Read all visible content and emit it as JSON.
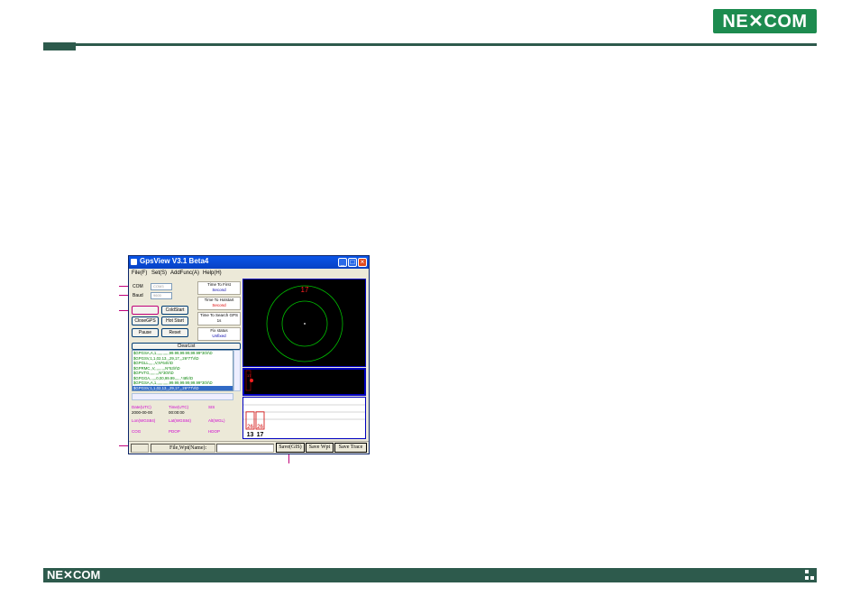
{
  "header": {
    "logo_text": "NE✕COM",
    "accent_color": "#2d5a4c",
    "logo_color": "#1d8b4f"
  },
  "footer": {
    "logo_text": "NE✕COM"
  },
  "window": {
    "title": "GpsView V3.1 Beta4",
    "menu": [
      "File(F)",
      "Set(S)",
      "AddFunc(A)",
      "Help(H)"
    ],
    "com_label": "COM",
    "com_value": "COM3",
    "baud_label": "Baud",
    "baud_value": "9600",
    "buttons": {
      "coldstart": "ColdStart",
      "closegps": "CloseGPS",
      "hotstart": "Hot Start",
      "pause": "Pause",
      "reset": "Reset",
      "clearlist": "ClearList"
    },
    "info": {
      "ttff_title": "Time To First",
      "ttff_value": "Second",
      "tthot_title": "Time To Hotstart",
      "tthot_value": "Second",
      "ttsearch_title": "Time To Search GPS",
      "ttsearch_value": "1s",
      "fix_title": "Fix status",
      "fix_value": "Unfixed"
    },
    "nmea_lines": [
      "$GPGSA,A,1,,,,,,,,,,,,99.99,99.99,99.99*30\\r\\D",
      "$GPGSV,1,1,02,13,,,29,17,,,26*77\\r\\D",
      "$GPGLL,,,,,,V,N*64\\r\\D",
      "$GPRMC,,V,,,,,,,,,,N*53\\r\\D",
      "$GPVTG,,,,,,,,,N*30\\r\\D",
      "$GPGGA,,,,,,0,00,99.99,,,,,,*48\\r\\D",
      "$GPGSA,A,1,,,,,,,,,,,,99.99,99.99,99.99*30\\r\\D",
      "$GPGSV,1,1,02,13,,,29,17,,,26*77\\r\\D"
    ],
    "stats": {
      "date_label": "Date(UTC)",
      "date_value": "2000-00-00",
      "time_label": "Time(UTC)",
      "time_value": "00:00:00",
      "sis_label": "SIS",
      "lon_label": "Lon(WGS84)",
      "lat_label": "Lat(WGS84)",
      "alt_label": "Alt(WGL)",
      "cog_label": "COG",
      "pdop_label": "PDOP",
      "hdop_label": "HDOP"
    },
    "sky": {
      "sat_label": "17"
    },
    "sig_label": "17",
    "signal": {
      "bars": [
        {
          "value_label": "26",
          "prn": "13",
          "level": 0.6
        },
        {
          "value_label": "26",
          "prn": "17",
          "level": 0.6
        }
      ]
    },
    "statusbar": {
      "file_label": "File,Wpt(Name):",
      "save_gis": "Save(GIS)",
      "save_wpt": "Save Wpt",
      "save_trace": "Save Trace"
    }
  }
}
